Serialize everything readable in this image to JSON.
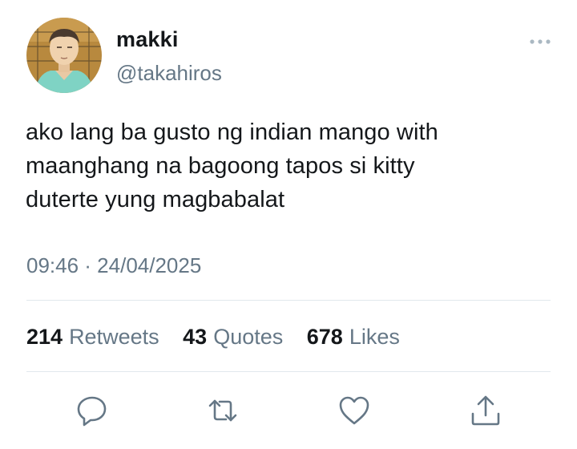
{
  "user": {
    "display_name": "makki",
    "handle": "@takahiros"
  },
  "tweet": {
    "text": "ako lang ba gusto ng indian mango with\nmaanghang na bagoong tapos si kitty\nduterte yung magbabalat",
    "timestamp": "09:46 · 24/04/2025"
  },
  "stats": {
    "retweets_count": "214",
    "retweets_label": "Retweets",
    "quotes_count": "43",
    "quotes_label": "Quotes",
    "likes_count": "678",
    "likes_label": "Likes"
  },
  "icons": {
    "more": "more-dots-icon",
    "reply": "reply-icon",
    "retweet": "retweet-icon",
    "like": "heart-icon",
    "share": "share-icon"
  },
  "colors": {
    "text": "#14171a",
    "secondary": "#657786",
    "icon": "#657786",
    "divider": "#e1e8ed"
  }
}
